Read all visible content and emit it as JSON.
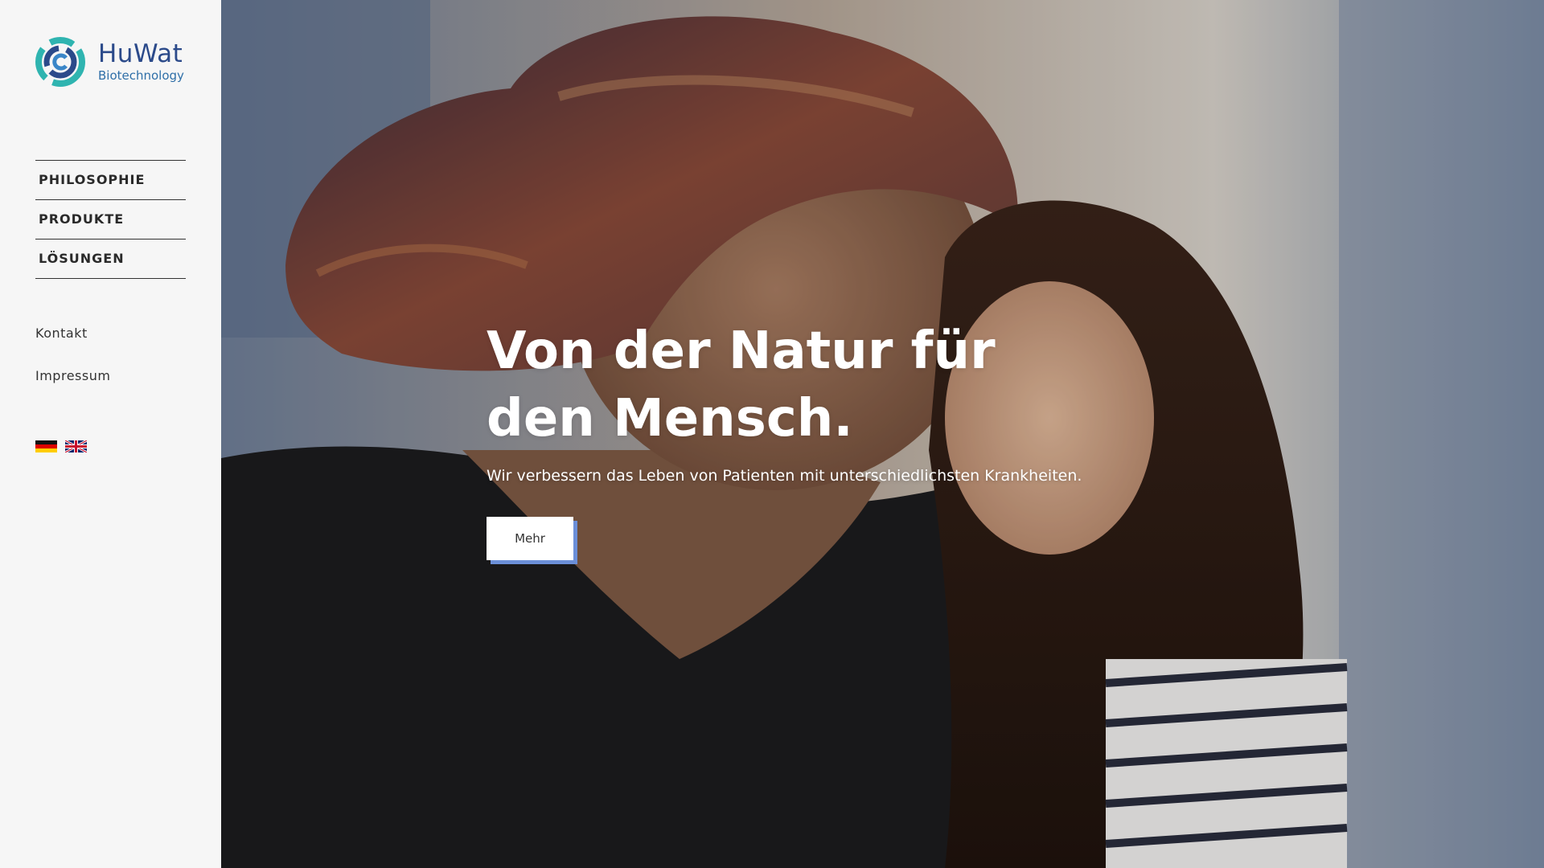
{
  "brand": {
    "name": "HuWat",
    "tagline": "Biotechnology",
    "colors": {
      "primary": "#2b4a8a",
      "teal": "#2fb4b0",
      "accent": "#6b8fd8"
    }
  },
  "nav": {
    "main": [
      {
        "label": "PHILOSOPHIE"
      },
      {
        "label": "PRODUKTE"
      },
      {
        "label": "LÖSUNGEN"
      }
    ],
    "secondary": [
      {
        "label": "Kontakt"
      },
      {
        "label": "Impressum"
      }
    ],
    "languages": [
      {
        "icon": "german-flag-icon"
      },
      {
        "icon": "uk-flag-icon"
      }
    ]
  },
  "hero": {
    "title": "Von der Natur für den Mensch.",
    "subtitle": "Wir verbessern das Leben von Patienten mit unterschiedlichsten Krankheiten.",
    "cta_label": "Mehr",
    "image": "photo-woman-and-girl-smiling"
  }
}
